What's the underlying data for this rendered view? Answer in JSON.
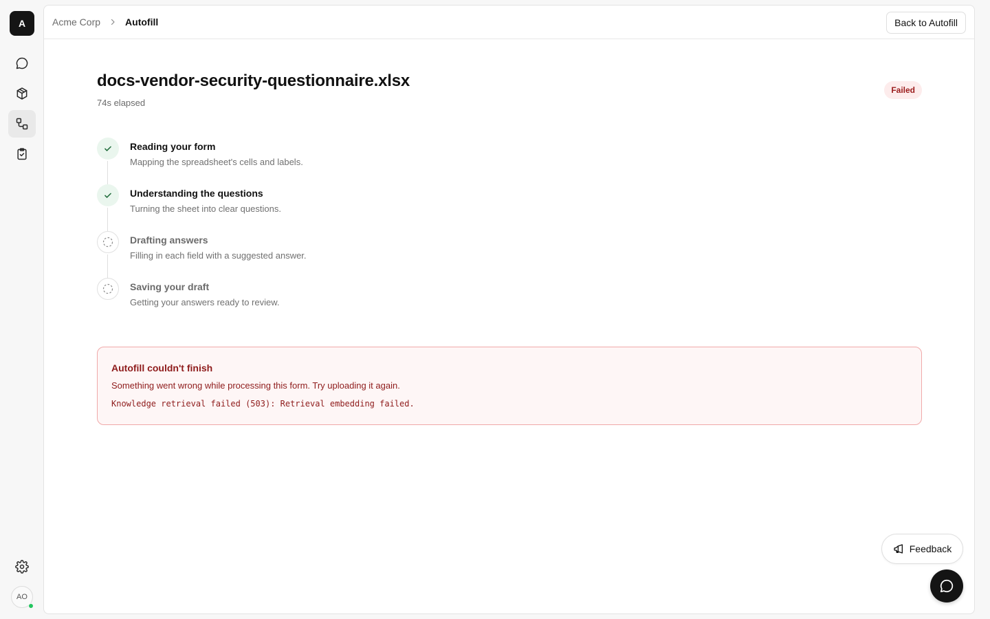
{
  "app": {
    "logo_letter": "A",
    "user_initials": "AO"
  },
  "sidebar": {
    "items": [
      {
        "icon": "chat-bubble-icon",
        "active": false
      },
      {
        "icon": "cube-icon",
        "active": false
      },
      {
        "icon": "workflow-icon",
        "active": true
      },
      {
        "icon": "clipboard-check-icon",
        "active": false
      }
    ],
    "settings_icon": "gear-icon"
  },
  "header": {
    "breadcrumb": {
      "parent": "Acme Corp",
      "current": "Autofill"
    },
    "back_button": "Back to Autofill"
  },
  "job": {
    "file_name": "docs-vendor-security-questionnaire.xlsx",
    "elapsed": "74s elapsed",
    "status": "Failed",
    "status_color": "#9b1c1c"
  },
  "steps": [
    {
      "title": "Reading your form",
      "description": "Mapping the spreadsheet's cells and labels.",
      "state": "done"
    },
    {
      "title": "Understanding the questions",
      "description": "Turning the sheet into clear questions.",
      "state": "done"
    },
    {
      "title": "Drafting answers",
      "description": "Filling in each field with a suggested answer.",
      "state": "pending"
    },
    {
      "title": "Saving your draft",
      "description": "Getting your answers ready to review.",
      "state": "pending"
    }
  ],
  "error": {
    "title": "Autofill couldn't finish",
    "message": "Something went wrong while processing this form. Try uploading it again.",
    "detail": "Knowledge retrieval failed (503): Retrieval embedding failed."
  },
  "feedback": {
    "label": "Feedback"
  },
  "colors": {
    "done_check": "#1f6b3a",
    "error_text": "#8e1b1b",
    "error_border": "#f0a8a8"
  }
}
